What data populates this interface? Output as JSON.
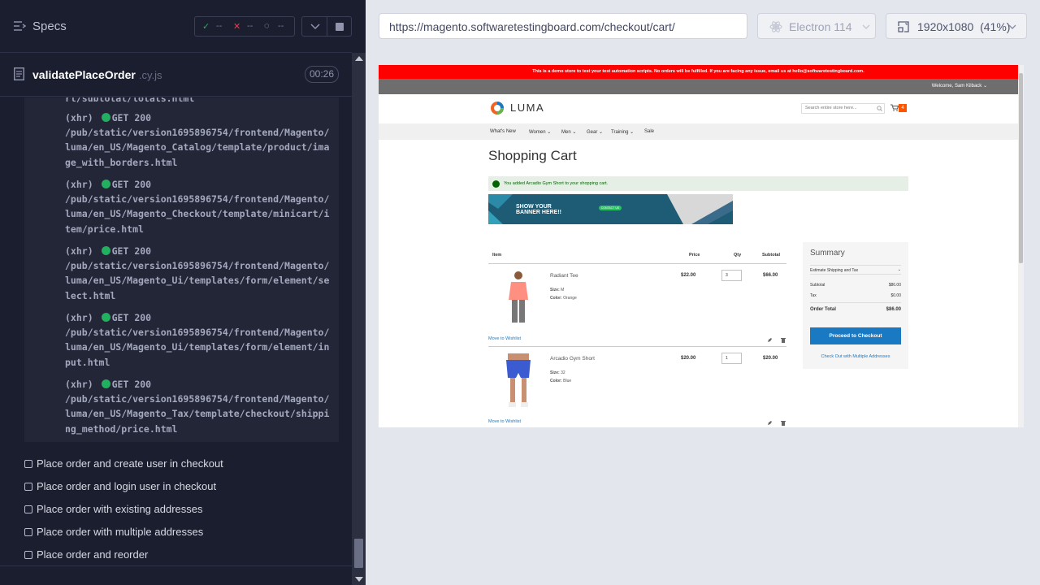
{
  "left": {
    "title": "Specs",
    "stats": {
      "passed": "--",
      "failed": "--",
      "pending": "--"
    },
    "spec": {
      "name": "validatePlaceOrder",
      "ext": ".cy.js",
      "time": "00:26"
    },
    "log": {
      "top_fragment": "rt/subtotal/totals.html",
      "entries": [
        {
          "tag": "(xhr)",
          "method": "GET 200",
          "lines": [
            "/pub/static/version1695896754/frontend/Magento/",
            "luma/en_US/Magento_Catalog/template/product/ima",
            "ge_with_borders.html"
          ]
        },
        {
          "tag": "(xhr)",
          "method": "GET 200",
          "lines": [
            "/pub/static/version1695896754/frontend/Magento/",
            "luma/en_US/Magento_Checkout/template/minicart/i",
            "tem/price.html"
          ]
        },
        {
          "tag": "(xhr)",
          "method": "GET 200",
          "lines": [
            "/pub/static/version1695896754/frontend/Magento/",
            "luma/en_US/Magento_Ui/templates/form/element/se",
            "lect.html"
          ]
        },
        {
          "tag": "(xhr)",
          "method": "GET 200",
          "lines": [
            "/pub/static/version1695896754/frontend/Magento/",
            "luma/en_US/Magento_Ui/templates/form/element/in",
            "put.html"
          ]
        },
        {
          "tag": "(xhr)",
          "method": "GET 200",
          "lines": [
            "/pub/static/version1695896754/frontend/Magento/",
            "luma/en_US/Magento_Tax/template/checkout/shippi",
            "ng_method/price.html"
          ]
        }
      ]
    },
    "tests": [
      "Place order and create user in checkout",
      "Place order and login user in checkout",
      "Place order with existing addresses",
      "Place order with multiple addresses",
      "Place order and reorder"
    ]
  },
  "topbar": {
    "url": "https://magento.softwaretestingboard.com/checkout/cart/",
    "browser": "Electron 114",
    "viewport": "1920x1080",
    "zoom": "(41%)"
  },
  "aut": {
    "demo_banner": "This is a demo store to test your test automation scripts. No orders will be fulfilled. If you are facing any issue, email us at hello@softwaretestingboard.com.",
    "welcome": "Welcome, Sam Kilback",
    "logo": "LUMA",
    "search_placeholder": "Search entire store here...",
    "cart_count": "4",
    "nav": [
      "What's New",
      "Women",
      "Men",
      "Gear",
      "Training",
      "Sale"
    ],
    "page_title": "Shopping Cart",
    "success_message": "You added Arcadio Gym Short to your shopping cart.",
    "banner_text_1": "SHOW YOUR",
    "banner_text_2": "BANNER HERE!!",
    "banner_button": "CONTACT US",
    "table_headers": {
      "item": "Item",
      "price": "Price",
      "qty": "Qty",
      "subtotal": "Subtotal"
    },
    "items": [
      {
        "name": "Radiant Tee",
        "size_label": "Size:",
        "size": "M",
        "color_label": "Color:",
        "color": "Orange",
        "price": "$22.00",
        "qty": "3",
        "subtotal": "$66.00",
        "wishlist": "Move to Wishlist"
      },
      {
        "name": "Arcadio Gym Short",
        "size_label": "Size:",
        "size": "32",
        "color_label": "Color:",
        "color": "Blue",
        "price": "$20.00",
        "qty": "1",
        "subtotal": "$20.00",
        "wishlist": "Move to Wishlist"
      }
    ],
    "summary": {
      "title": "Summary",
      "estimate": "Estimate Shipping and Tax",
      "subtotal_label": "Subtotal",
      "subtotal": "$86.00",
      "tax_label": "Tax",
      "tax": "$0.00",
      "total_label": "Order Total",
      "total": "$86.00",
      "checkout": "Proceed to Checkout",
      "multi": "Check Out with Multiple Addresses"
    }
  },
  "colors": {
    "accent": "#1979c3",
    "error": "#ff0000",
    "success": "#20b060"
  }
}
